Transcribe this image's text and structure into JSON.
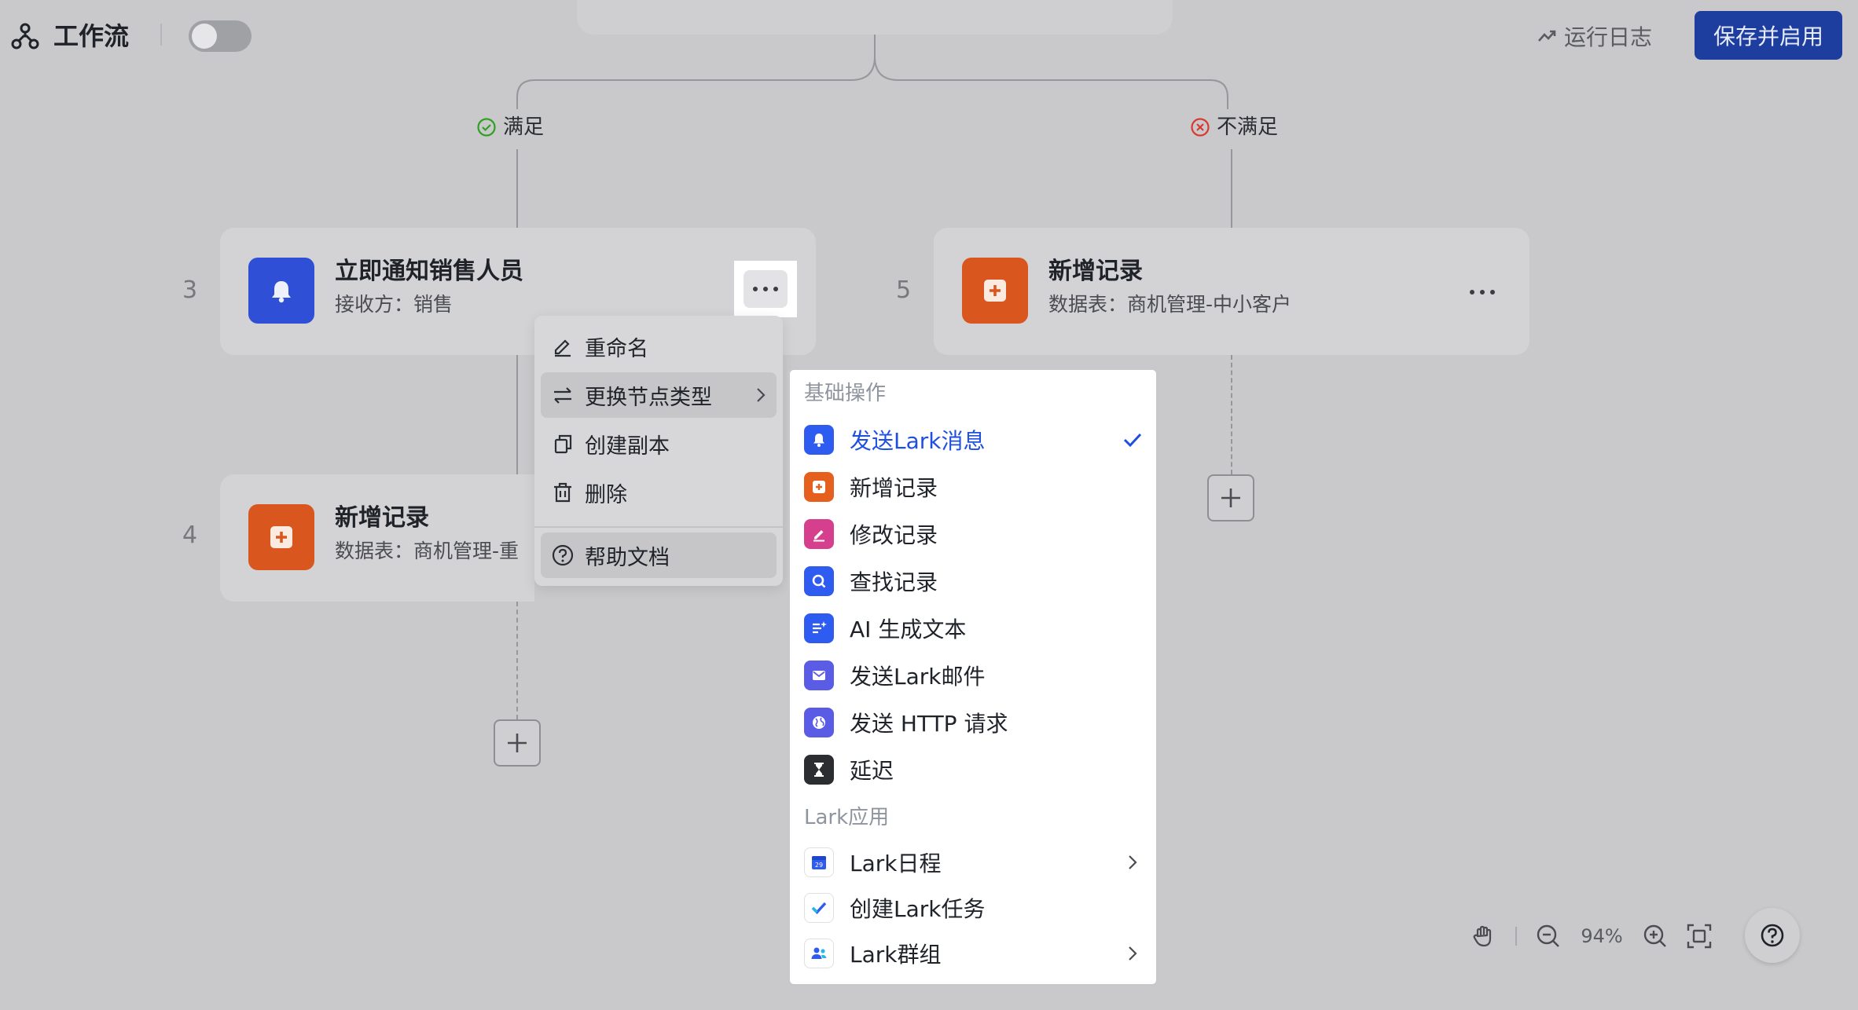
{
  "header": {
    "title": "工作流",
    "run_log_label": "运行日志",
    "save_label": "保存并启用",
    "enabled": false
  },
  "branches": {
    "yes_label": "满足",
    "no_label": "不满足"
  },
  "nodes": [
    {
      "number": "3",
      "title": "立即通知销售人员",
      "subtitle": "接收方：销售",
      "icon": "bell-icon",
      "color": "#2e4fd6"
    },
    {
      "number": "4",
      "title": "新增记录",
      "subtitle": "数据表：商机管理-重",
      "icon": "add-record-icon",
      "color": "#d9561f"
    },
    {
      "number": "5",
      "title": "新增记录",
      "subtitle": "数据表：商机管理-中小客户",
      "icon": "add-record-icon",
      "color": "#d9561f"
    }
  ],
  "context_menu": {
    "items": [
      {
        "label": "重命名",
        "icon": "edit-icon"
      },
      {
        "label": "更换节点类型",
        "icon": "swap-icon",
        "has_submenu": true
      },
      {
        "label": "创建副本",
        "icon": "copy-icon"
      },
      {
        "label": "删除",
        "icon": "trash-icon"
      },
      {
        "label": "帮助文档",
        "icon": "help-icon"
      }
    ]
  },
  "submenu": {
    "section_basic": "基础操作",
    "section_lark": "Lark应用",
    "items": [
      {
        "label": "发送Lark消息",
        "icon": "bell-icon",
        "color": "#2e5bf0",
        "selected": true
      },
      {
        "label": "新增记录",
        "icon": "add-record-icon",
        "color": "#e5601f"
      },
      {
        "label": "修改记录",
        "icon": "edit-record-icon",
        "color": "#d63e8e"
      },
      {
        "label": "查找记录",
        "icon": "search-icon",
        "color": "#2e5bf0"
      },
      {
        "label": "AI 生成文本",
        "icon": "ai-text-icon",
        "color": "#2e5bf0"
      },
      {
        "label": "发送Lark邮件",
        "icon": "mail-icon",
        "color": "#5b5ce6"
      },
      {
        "label": "发送 HTTP 请求",
        "icon": "globe-icon",
        "color": "#5b5ce6"
      },
      {
        "label": "延迟",
        "icon": "hourglass-icon",
        "color": "#2b2d31"
      },
      {
        "label": "Lark日程",
        "icon": "calendar-icon",
        "color": "#2e5bf0",
        "calendar_day": "29",
        "has_submenu": true
      },
      {
        "label": "创建Lark任务",
        "icon": "task-check-icon",
        "color": "#2e5bf0"
      },
      {
        "label": "Lark群组",
        "icon": "group-icon",
        "color": "#2e5bf0",
        "has_submenu": true
      }
    ]
  },
  "zoom": {
    "value": "94%"
  }
}
